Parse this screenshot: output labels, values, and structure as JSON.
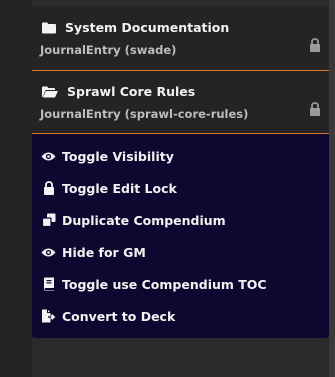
{
  "entries": [
    {
      "title": "System Documentation",
      "subtitle": "JournalEntry (swade)",
      "icon": "folder-icon"
    },
    {
      "title": "Sprawl Core Rules",
      "subtitle": "JournalEntry (sprawl-core-rules)",
      "icon": "folder-open-icon"
    }
  ],
  "menu": {
    "items": [
      {
        "label": "Toggle Visibility",
        "icon": "eye-icon"
      },
      {
        "label": "Toggle Edit Lock",
        "icon": "lock-icon"
      },
      {
        "label": "Duplicate Compendium",
        "icon": "copy-icon"
      },
      {
        "label": "Hide for GM",
        "icon": "eye-icon"
      },
      {
        "label": "Toggle use Compendium TOC",
        "icon": "book-icon"
      },
      {
        "label": "Convert to Deck",
        "icon": "file-export-icon"
      }
    ]
  },
  "colors": {
    "accent": "#d9732a",
    "menu_bg": "#0f0730"
  }
}
